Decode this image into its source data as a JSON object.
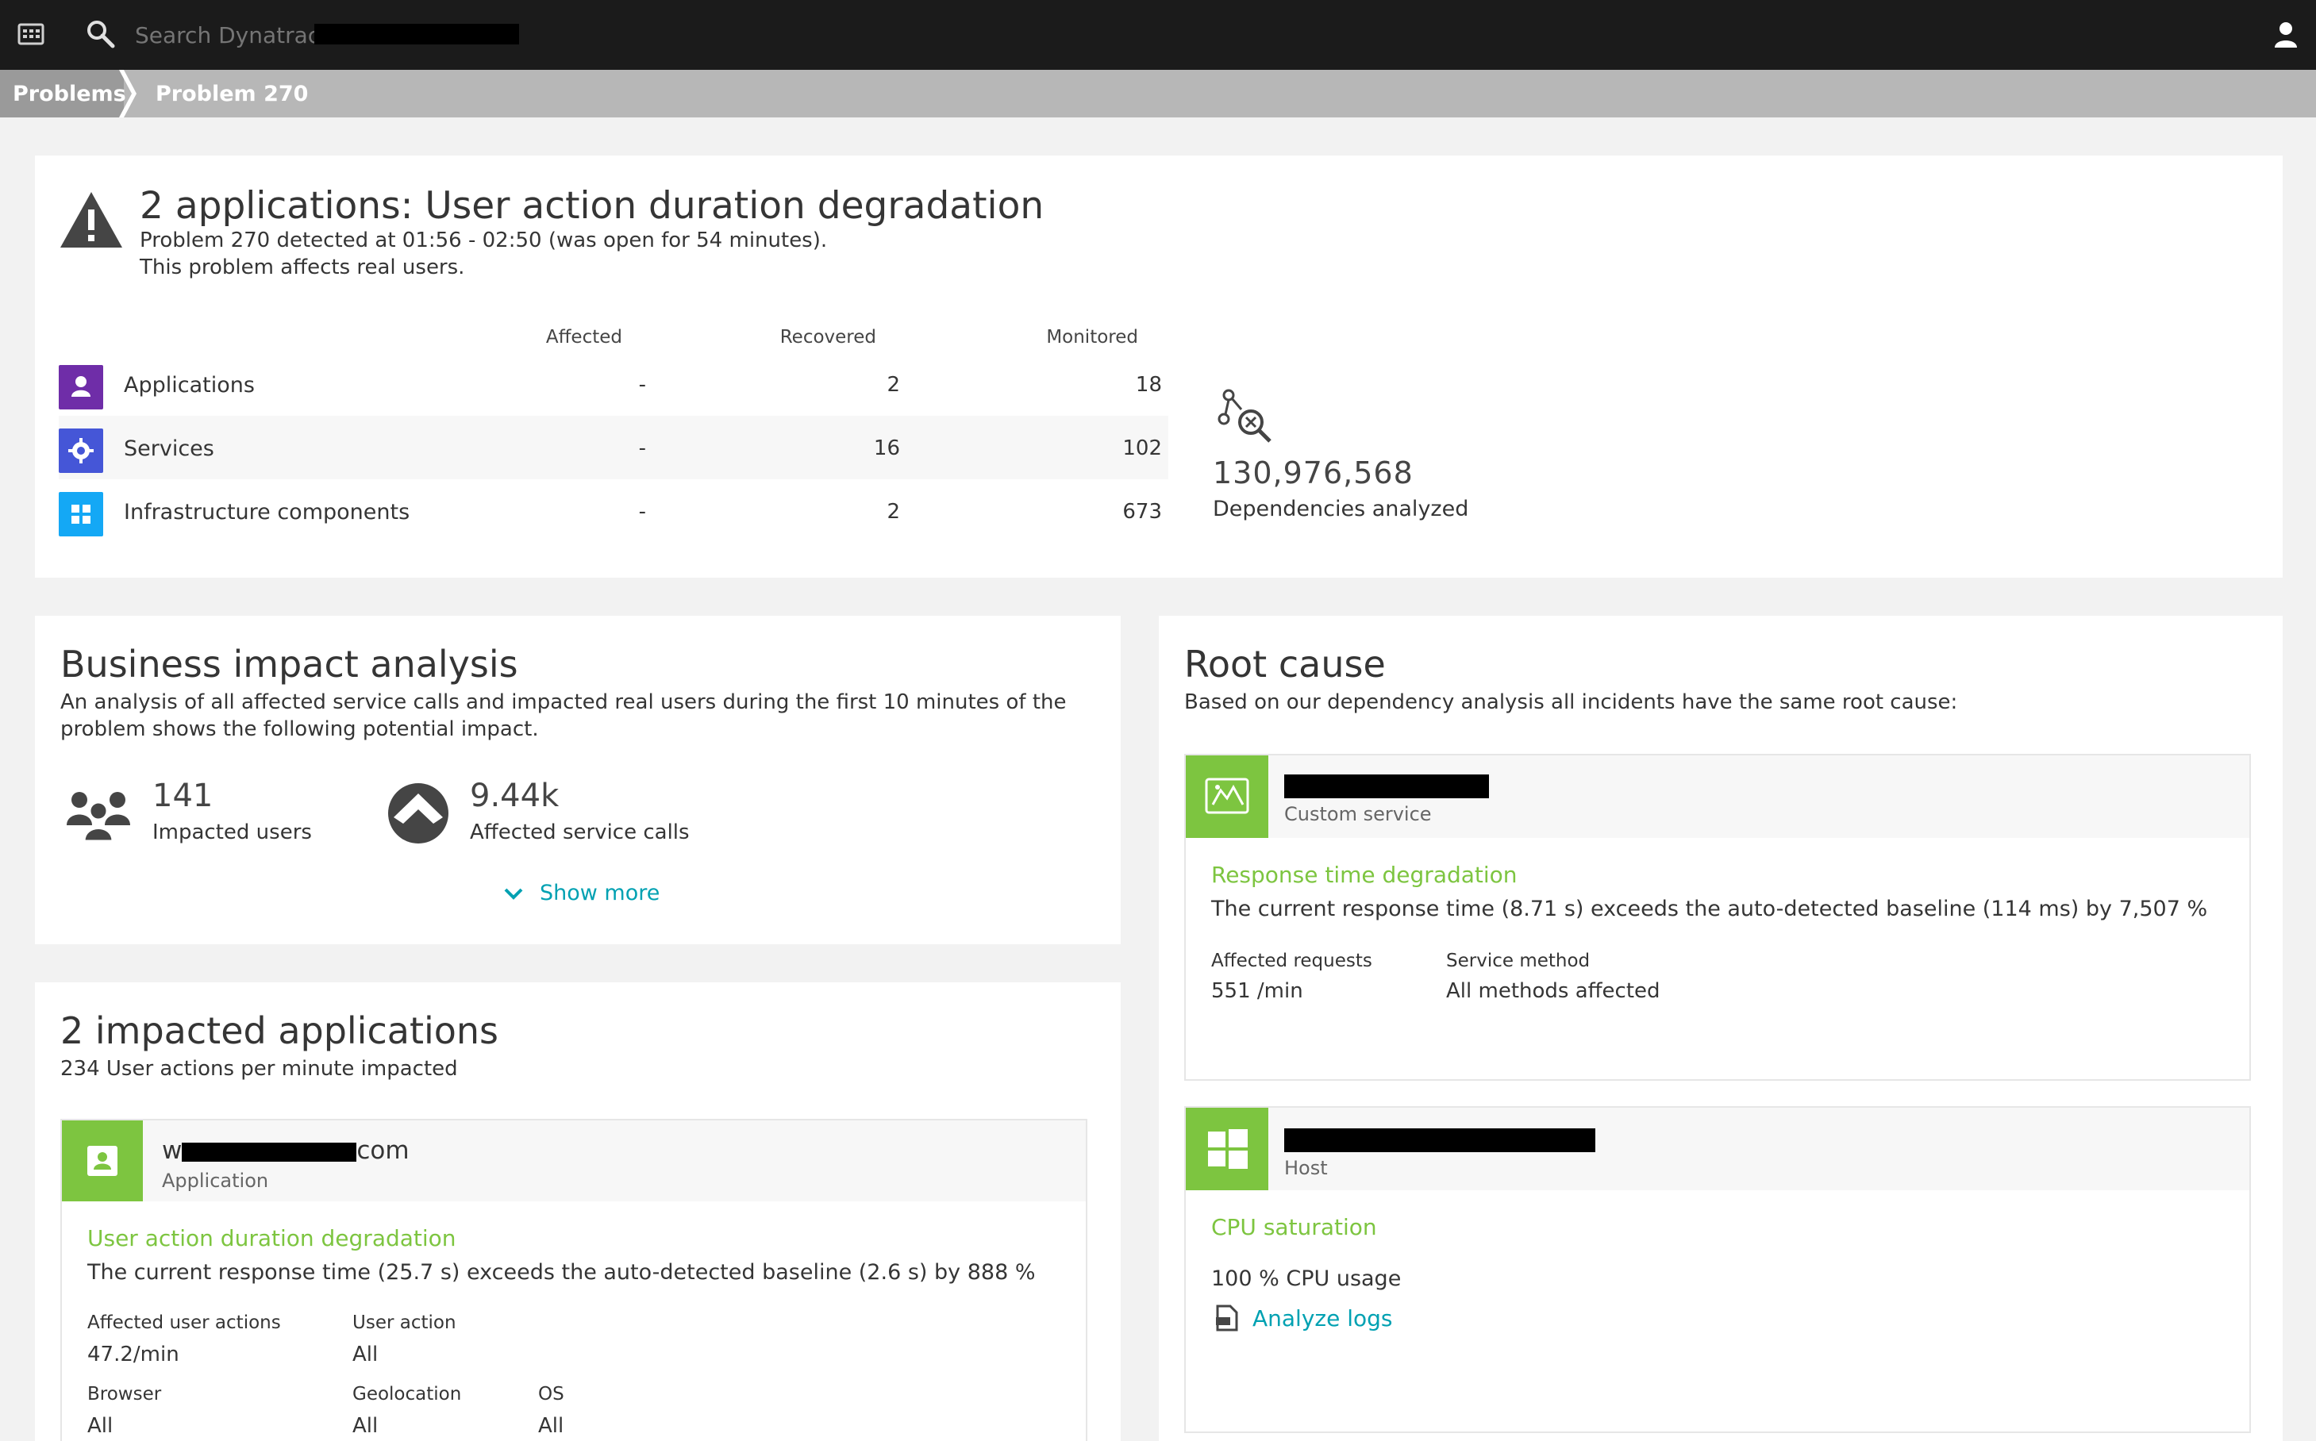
{
  "topbar": {
    "search_placeholder": "Search Dynatrace"
  },
  "breadcrumb": {
    "root": "Problems",
    "current": "Problem 270"
  },
  "problem": {
    "title": "2 applications: User action duration degradation",
    "detected": "Problem 270 detected at 01:56 - 02:50 (was open for 54 minutes).",
    "affects": "This problem affects real users.",
    "columns": [
      "Affected",
      "Recovered",
      "Monitored"
    ],
    "rows": [
      {
        "label": "Applications",
        "affected": "-",
        "recovered": "2",
        "monitored": "18",
        "icon": "application-icon",
        "color": "#6f2da8"
      },
      {
        "label": "Services",
        "affected": "-",
        "recovered": "16",
        "monitored": "102",
        "icon": "service-gear-icon",
        "color": "#4556d7"
      },
      {
        "label": "Infrastructure components",
        "affected": "-",
        "recovered": "2",
        "monitored": "673",
        "icon": "infrastructure-icon",
        "color": "#14a8f5"
      }
    ],
    "dependencies_count": "130,976,568",
    "dependencies_label": "Dependencies analyzed"
  },
  "business_impact": {
    "title": "Business impact analysis",
    "description": "An analysis of all affected service calls and impacted real users during the first 10 minutes of the problem shows the following potential impact.",
    "users_value": "141",
    "users_label": "Impacted users",
    "calls_value": "9.44k",
    "calls_label": "Affected service calls",
    "show_more": "Show more"
  },
  "impacted_apps": {
    "title": "2 impacted applications",
    "subtitle": "234 User actions per minute impacted",
    "app": {
      "name_prefix": "w",
      "name_suffix": "com",
      "type": "Application",
      "event_title": "User action duration degradation",
      "event_desc": "The current response time (25.7 s) exceeds the auto-detected baseline (2.6 s) by 888 %",
      "affected_user_actions_label": "Affected user actions",
      "affected_user_actions_value": "47.2/min",
      "user_action_label": "User action",
      "user_action_value": "All",
      "browser_label": "Browser",
      "browser_value": "All",
      "geolocation_label": "Geolocation",
      "geolocation_value": "All",
      "os_label": "OS",
      "os_value": "All"
    }
  },
  "root_cause": {
    "title": "Root cause",
    "subtitle": "Based on our dependency analysis all incidents have the same root cause:",
    "service": {
      "type": "Custom service",
      "event_title": "Response time degradation",
      "event_desc": "The current response time (8.71 s) exceeds the auto-detected baseline (114 ms) by 7,507 %",
      "affected_requests_label": "Affected requests",
      "affected_requests_value": "551 /min",
      "service_method_label": "Service method",
      "service_method_value": "All methods affected"
    },
    "host": {
      "type": "Host",
      "event_title": "CPU saturation",
      "cpu_usage": "100 % CPU usage",
      "analyze_logs": "Analyze logs"
    }
  },
  "colors": {
    "accent_green": "#7dc540",
    "link_teal": "#00a1b2",
    "topbar": "#1b1b1b"
  }
}
